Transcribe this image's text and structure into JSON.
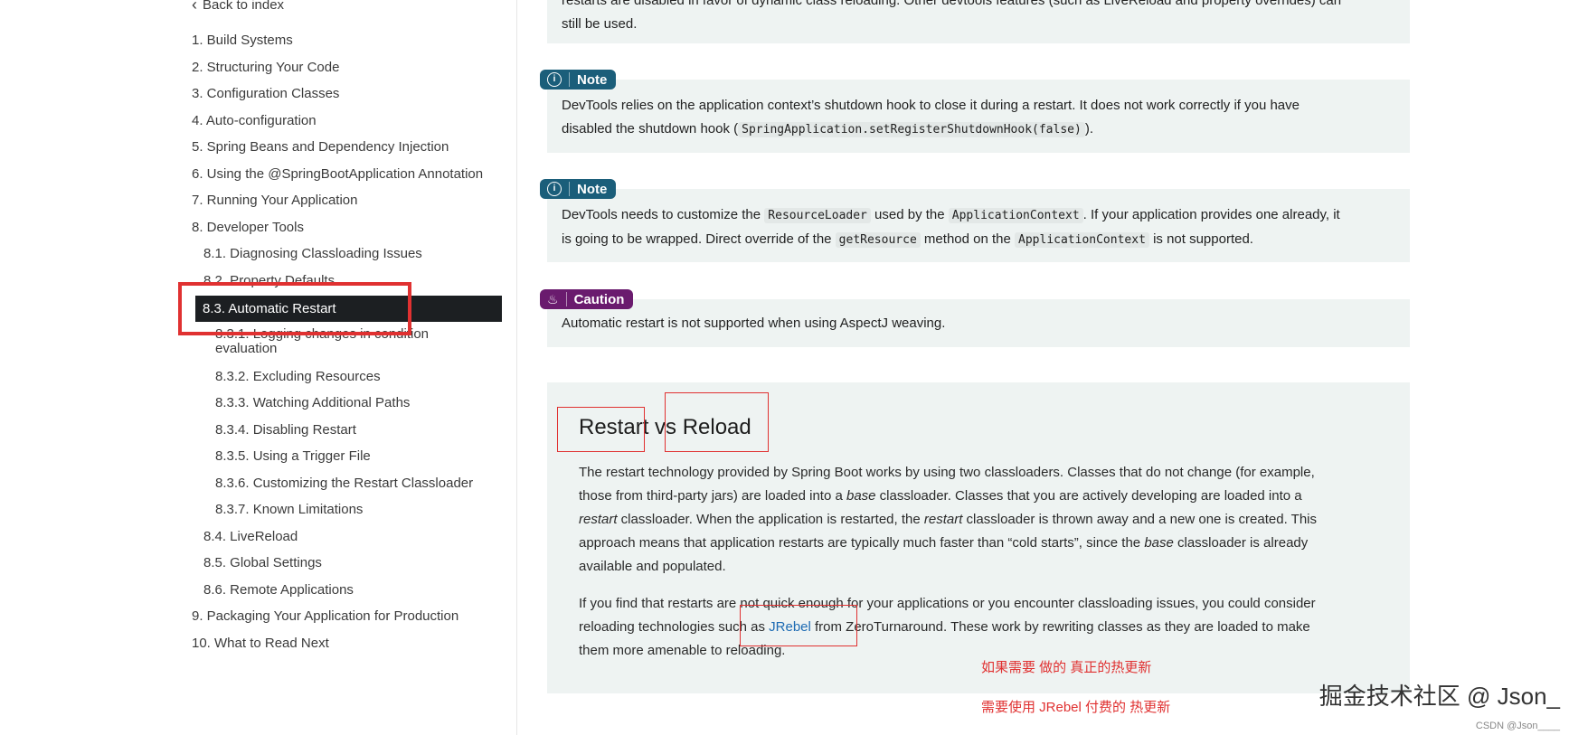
{
  "sidebar": {
    "back_link": "Back to index",
    "toc": [
      {
        "label": "1. Build Systems",
        "level": 1
      },
      {
        "label": "2. Structuring Your Code",
        "level": 1
      },
      {
        "label": "3. Configuration Classes",
        "level": 1
      },
      {
        "label": "4. Auto-configuration",
        "level": 1
      },
      {
        "label": "5. Spring Beans and Dependency Injection",
        "level": 1
      },
      {
        "label": "6. Using the @SpringBootApplication Annotation",
        "level": 1
      },
      {
        "label": "7. Running Your Application",
        "level": 1
      },
      {
        "label": "8. Developer Tools",
        "level": 1
      },
      {
        "label": "8.1. Diagnosing Classloading Issues",
        "level": 2
      },
      {
        "label": "8.2. Property Defaults",
        "level": 2
      },
      {
        "label": "8.3. Automatic Restart",
        "level": 2,
        "active": true
      },
      {
        "label": "8.3.1. Logging changes in condition evaluation",
        "level": 3
      },
      {
        "label": "8.3.2. Excluding Resources",
        "level": 3
      },
      {
        "label": "8.3.3. Watching Additional Paths",
        "level": 3
      },
      {
        "label": "8.3.4. Disabling Restart",
        "level": 3
      },
      {
        "label": "8.3.5. Using a Trigger File",
        "level": 3
      },
      {
        "label": "8.3.6. Customizing the Restart Classloader",
        "level": 3
      },
      {
        "label": "8.3.7. Known Limitations",
        "level": 3
      },
      {
        "label": "8.4. LiveReload",
        "level": 2
      },
      {
        "label": "8.5. Global Settings",
        "level": 2
      },
      {
        "label": "8.6. Remote Applications",
        "level": 2
      },
      {
        "label": "9. Packaging Your Application for Production",
        "level": 1
      },
      {
        "label": "10. What to Read Next",
        "level": 1
      }
    ]
  },
  "main": {
    "top_box": {
      "line1": "restarts are disabled in favor of dynamic class reloading. Other devtools features (such as LiveReload and property overrides) can",
      "line2": "still be used."
    },
    "note1": {
      "badge": "Note",
      "text_a": "DevTools relies on the application context’s shutdown hook to close it during a restart. It does not work correctly if you have",
      "text_b": "disabled the shutdown hook (",
      "code": "SpringApplication.setRegisterShutdownHook(false)",
      "text_c": ")."
    },
    "note2": {
      "badge": "Note",
      "t1": "DevTools needs to customize the ",
      "c1": "ResourceLoader",
      "t2": " used by the ",
      "c2": "ApplicationContext",
      "t3": ". If your application provides one already, it",
      "t4": "is going to be wrapped. Direct override of the ",
      "c3": "getResource",
      "t5": " method on the ",
      "c4": "ApplicationContext",
      "t6": " is not supported."
    },
    "caution": {
      "badge": "Caution",
      "text": "Automatic restart is not supported when using AspectJ weaving."
    },
    "section": {
      "title": "Restart vs Reload",
      "p1_l1_a": "The restart technology provided by Spring Boot works by using two classloaders. Classes that do not change (for example,",
      "p1_l2_a": "those from third-party jars) are loaded into a ",
      "p1_l2_em": "base",
      "p1_l2_b": " classloader. Classes that you are actively developing are loaded into a",
      "p1_l3_em": "restart",
      "p1_l3_a": " classloader. When the application is restarted, the ",
      "p1_l3_em2": "restart",
      "p1_l3_b": " classloader is thrown away and a new one is created. This",
      "p1_l4_a": "approach means that application restarts are typically much faster than “cold starts”, since the ",
      "p1_l4_em": "base",
      "p1_l4_b": " classloader is already",
      "p1_l5": "available and populated.",
      "p2_l1": "If you find that restarts are not quick enough for your applications or you encounter classloading issues, you could consider",
      "p2_l2_a": "reloading technologies such as ",
      "p2_link": "JRebel",
      "p2_l2_b": " from ZeroTurnaround. These work by rewriting classes as they are loaded to make",
      "p2_l3": "them more amenable to reloading."
    },
    "annotations": {
      "cn1": "如果需要 做的 真正的热更新",
      "cn2": "需要使用 JRebel  付费的 热更新"
    },
    "watermark": "掘金技术社区 @ Json_",
    "watermark_small": "CSDN @Json____"
  },
  "colors": {
    "accent_red": "#e03131",
    "note_badge": "#1b5e7a",
    "caution_badge": "#6a1b6e",
    "admonition_bg": "#eef3f2",
    "active_toc_bg": "#1c1f22",
    "link": "#1d6bb3"
  }
}
